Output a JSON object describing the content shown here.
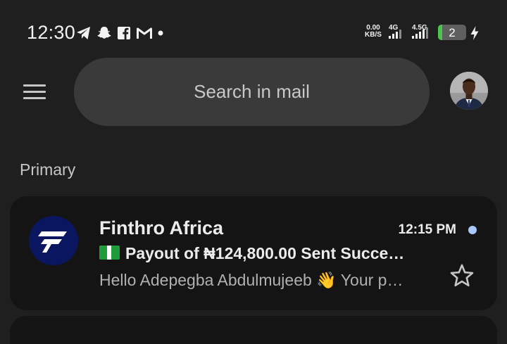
{
  "status_bar": {
    "time": "12:30",
    "notification_icons": [
      "telegram-icon",
      "snapchat-icon",
      "facebook-icon",
      "gmail-icon",
      "more-dot-icon"
    ],
    "net_speed": "0.00",
    "net_unit": "KB/S",
    "sim1_label": "4G",
    "sim2_label": "4.5G",
    "battery_level": "2",
    "colors": {
      "battery_fill": "#4cc54c",
      "battery_bg": "#5f5f5f"
    }
  },
  "header": {
    "menu_icon": "hamburger-menu-icon",
    "search_placeholder": "Search in mail",
    "avatar_icon": "profile-avatar"
  },
  "section": {
    "label": "Primary"
  },
  "emails": [
    {
      "sender": "Finthro Africa",
      "time": "12:15 PM",
      "subject_flag": "nigeria-flag-icon",
      "subject": "Payout of ₦124,800.00 Sent Succe…",
      "snippet": "Hello Adepegba Abdulmujeeb 👋 Your p…",
      "unread": true,
      "starred": false,
      "logo_color": "#0b1660"
    }
  ],
  "colors": {
    "background": "#1f1f1f",
    "card": "#141414",
    "search_bar": "#3a3a3a",
    "unread_dot": "#a8c7fa"
  }
}
